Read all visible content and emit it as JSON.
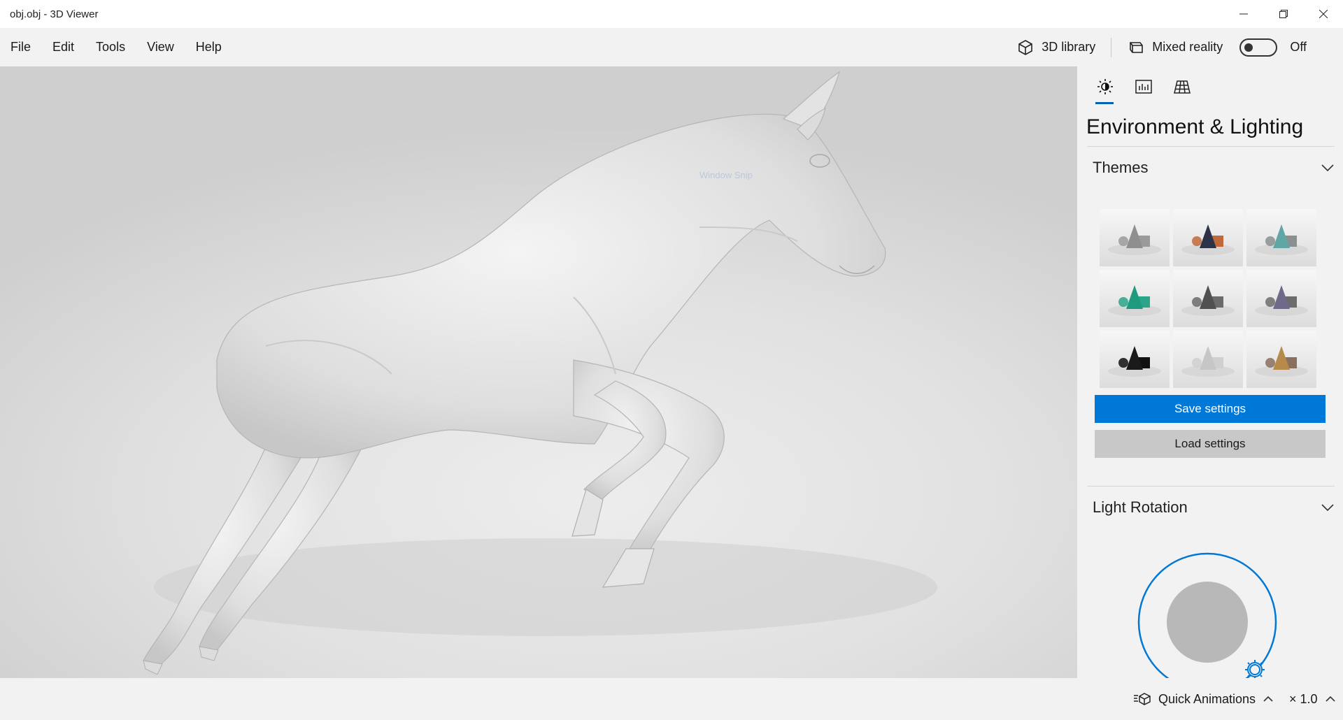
{
  "window": {
    "title": "obj.obj - 3D Viewer"
  },
  "menu": {
    "items": [
      "File",
      "Edit",
      "Tools",
      "View",
      "Help"
    ]
  },
  "toolbar": {
    "library_label": "3D library",
    "mixed_reality_label": "Mixed reality",
    "mixed_reality_state": "Off",
    "mixed_reality_on": false
  },
  "viewport": {
    "overlay_text": "Window Snip"
  },
  "panel": {
    "tabs": [
      "environment-lighting",
      "stats",
      "grid"
    ],
    "active_tab": "environment-lighting",
    "title": "Environment & Lighting",
    "themes_section": {
      "label": "Themes",
      "themes": [
        {
          "cone": "#8f8f8f",
          "box": "#9a9a9a",
          "bg": "light"
        },
        {
          "cone": "#2c3348",
          "box": "#c0683a",
          "bg": "light"
        },
        {
          "cone": "#5fa6a4",
          "box": "#8a8f90",
          "bg": "light"
        },
        {
          "cone": "#1f9a7e",
          "box": "#2aa58a",
          "bg": "light"
        },
        {
          "cone": "#4f5151",
          "box": "#6a6c6c",
          "bg": "light"
        },
        {
          "cone": "#6f6a8a",
          "box": "#6c6c6c",
          "bg": "light"
        },
        {
          "cone": "#1a1a1a",
          "box": "#111111",
          "bg": "light"
        },
        {
          "cone": "#c6c6c6",
          "box": "#cfcfcf",
          "bg": "light"
        },
        {
          "cone": "#b58a4a",
          "box": "#8a6e5e",
          "bg": "light"
        }
      ],
      "save_label": "Save settings",
      "load_label": "Load settings"
    },
    "light_rotation_section": {
      "label": "Light Rotation"
    }
  },
  "status": {
    "quick_animations_label": "Quick Animations",
    "speed_label": "× 1.0"
  },
  "colors": {
    "accent": "#0078d7",
    "accent_dark": "#0063b1"
  }
}
